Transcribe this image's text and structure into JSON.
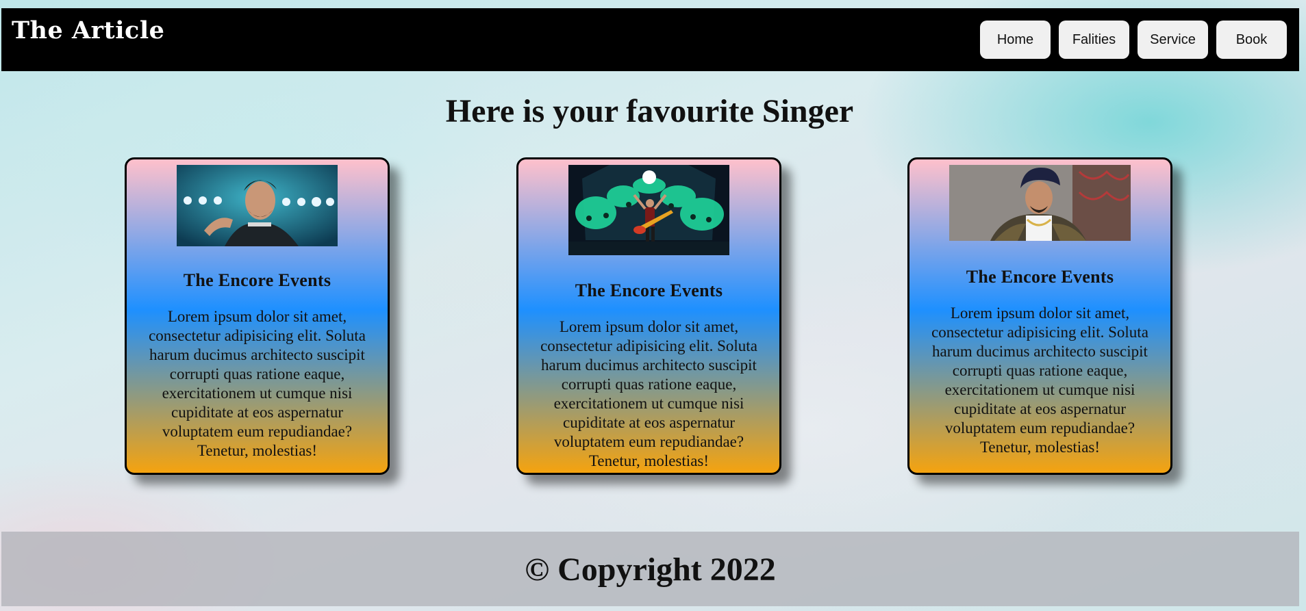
{
  "header": {
    "brand": "The Article",
    "nav": [
      "Home",
      "Falities",
      "Service",
      "Book"
    ]
  },
  "main": {
    "headline": "Here is your favourite Singer",
    "cards": [
      {
        "title": "The Encore Events",
        "text": "Lorem ipsum dolor sit amet, consectetur adipisicing elit. Soluta harum ducimus architecto suscipit corrupti quas ratione eaque, exercitationem ut cumque nisi cupiditate at eos aspernatur voluptatem eum repudiandae? Tenetur, molestias!"
      },
      {
        "title": "The Encore Events",
        "text": "Lorem ipsum dolor sit amet, consectetur adipisicing elit. Soluta harum ducimus architecto suscipit corrupti quas ratione eaque, exercitationem ut cumque nisi cupiditate at eos aspernatur voluptatem eum repudiandae? Tenetur, molestias!"
      },
      {
        "title": "The Encore Events",
        "text": "Lorem ipsum dolor sit amet, consectetur adipisicing elit. Soluta harum ducimus architecto suscipit corrupti quas ratione eaque, exercitationem ut cumque nisi cupiditate at eos aspernatur voluptatem eum repudiandae? Tenetur, molestias!"
      }
    ]
  },
  "footer": {
    "text": "© Copyright 2022"
  },
  "colors": {
    "header_bg": "#000000",
    "card_gradient": [
      "#ffc0cb",
      "#1e90ff",
      "#f5a30f"
    ],
    "nav_button_bg": "#f0f0f0"
  }
}
